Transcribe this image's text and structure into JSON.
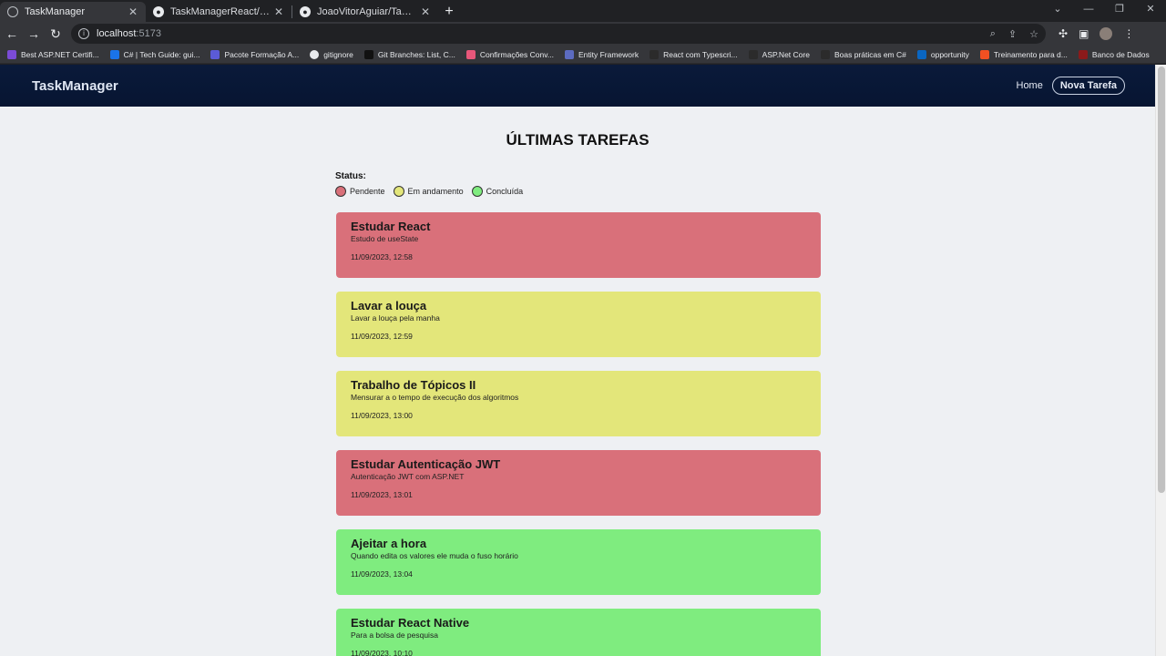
{
  "browser": {
    "tabs": [
      {
        "title": "TaskManager",
        "active": true,
        "icon": "globe-icon"
      },
      {
        "title": "TaskManagerReact/README.md",
        "active": false,
        "icon": "github-icon"
      },
      {
        "title": "JoaoVitorAguiar/TaskManagerR",
        "active": false,
        "icon": "github-icon"
      }
    ],
    "url_host": "localhost",
    "url_port": ":5173",
    "bookmarks": [
      {
        "label": "Best ASP.NET Certifi...",
        "color": "#7b4bd6",
        "icon": "bookmark-icon"
      },
      {
        "label": "C# | Tech Guide: gui...",
        "color": "#1a73e8",
        "icon": "bookmark-icon"
      },
      {
        "label": "Pacote Formação A...",
        "color": "#5b5bd6",
        "icon": "bookmark-icon"
      },
      {
        "label": "gitignore",
        "color": "#e8eaed",
        "icon": "bookmark-icon"
      },
      {
        "label": "Git Branches: List, C...",
        "color": "#111111",
        "icon": "bookmark-icon"
      },
      {
        "label": "Confirmações Conv...",
        "color": "#e8577a",
        "icon": "bookmark-icon"
      },
      {
        "label": "Entity Framework",
        "color": "#5c6bc0",
        "icon": "bookmark-icon"
      },
      {
        "label": "React com Typescri...",
        "color": "#2b2b2b",
        "icon": "bookmark-icon"
      },
      {
        "label": "ASP.Net Core",
        "color": "#2b2b2b",
        "icon": "bookmark-icon"
      },
      {
        "label": "Boas práticas em C#",
        "color": "#2b2b2b",
        "icon": "bookmark-icon"
      },
      {
        "label": "opportunity",
        "color": "#0a66c2",
        "icon": "bookmark-icon"
      },
      {
        "label": "Treinamento para d...",
        "color": "#f25022",
        "icon": "bookmark-icon"
      },
      {
        "label": "Banco de Dados",
        "color": "#8b1a1a",
        "icon": "bookmark-icon"
      }
    ]
  },
  "navbar": {
    "brand": "TaskManager",
    "home": "Home",
    "new_task": "Nova Tarefa"
  },
  "page": {
    "heading": "ÚLTIMAS TAREFAS",
    "status_label": "Status:",
    "legend": [
      {
        "label": "Pendente",
        "color": "#d9707a"
      },
      {
        "label": "Em andamento",
        "color": "#e3e67a"
      },
      {
        "label": "Concluída",
        "color": "#7fec7f"
      }
    ]
  },
  "tasks": [
    {
      "title": "Estudar React",
      "description": "Estudo de useState",
      "date": "11/09/2023, 12:58",
      "status_color": "#d9707a"
    },
    {
      "title": "Lavar a louça",
      "description": "Lavar a louça pela manha",
      "date": "11/09/2023, 12:59",
      "status_color": "#e3e67a"
    },
    {
      "title": "Trabalho de Tópicos II",
      "description": "Mensurar a o tempo de execução dos algoritmos",
      "date": "11/09/2023, 13:00",
      "status_color": "#e3e67a"
    },
    {
      "title": "Estudar Autenticação JWT",
      "description": "Autenticação JWT com ASP.NET",
      "date": "11/09/2023, 13:01",
      "status_color": "#d9707a"
    },
    {
      "title": "Ajeitar a hora",
      "description": "Quando edita os valores ele muda o fuso horário",
      "date": "11/09/2023, 13:04",
      "status_color": "#7fec7f"
    },
    {
      "title": "Estudar React Native",
      "description": "Para a bolsa de pesquisa",
      "date": "11/09/2023, 10:10",
      "status_color": "#7fec7f"
    }
  ]
}
